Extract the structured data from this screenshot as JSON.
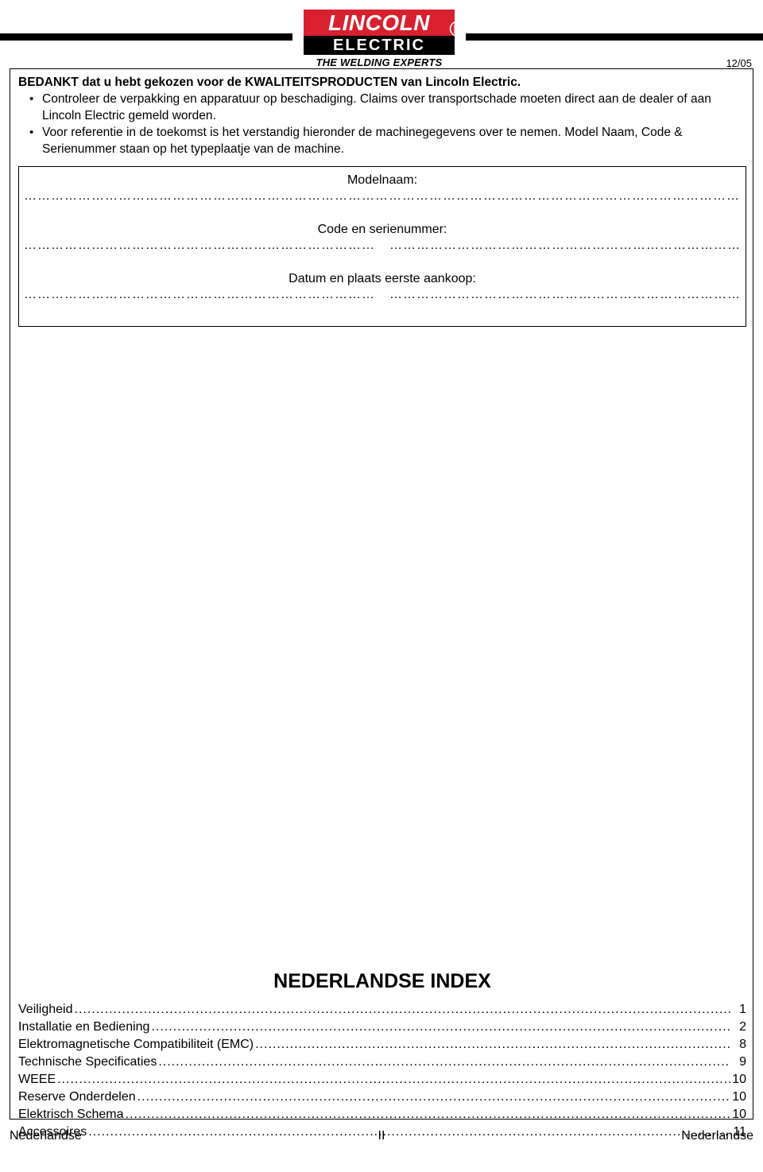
{
  "header": {
    "logo": {
      "brand": "LINCOLN",
      "registered": "®",
      "product": "ELECTRIC",
      "tagline": "THE WELDING EXPERTS"
    },
    "date_stamp": "12/05"
  },
  "intro": {
    "lead": "BEDANKT dat u hebt gekozen voor de KWALITEITSPRODUCTEN van Lincoln Electric.",
    "bullets": [
      "Controleer de verpakking en apparatuur op beschadiging. Claims over transportschade moeten direct aan de dealer of aan Lincoln Electric gemeld worden.",
      "Voor referentie in de toekomst is het verstandig hieronder de machinegegevens over te nemen. Model Naam, Code & Serienummer staan op het typeplaatje van de machine."
    ]
  },
  "record": {
    "model_label": "Modelnaam:",
    "code_label": "Code en serienummer:",
    "date_place_label": "Datum en plaats eerste aankoop:",
    "dots": "…………………………………………………………………………………………………………………………………………………………………………………………………………………………………………………………………………………………………"
  },
  "index": {
    "title": "NEDERLANDSE INDEX",
    "leader": "................................................................................................................................................................................................................................................",
    "entries": [
      {
        "label": "Veiligheid",
        "page": "1"
      },
      {
        "label": "Installatie en Bediening",
        "page": "2"
      },
      {
        "label": "Elektromagnetische Compatibiliteit (EMC)",
        "page": "8"
      },
      {
        "label": "Technische Specificaties",
        "page": "9"
      },
      {
        "label": "WEEE",
        "page": "10"
      },
      {
        "label": "Reserve Onderdelen",
        "page": "10"
      },
      {
        "label": "Elektrisch Schema",
        "page": "10"
      },
      {
        "label": "Accessoires",
        "page": "11"
      }
    ]
  },
  "footer": {
    "left": "Nederlandse",
    "center": "II",
    "right": "Nederlandse"
  }
}
